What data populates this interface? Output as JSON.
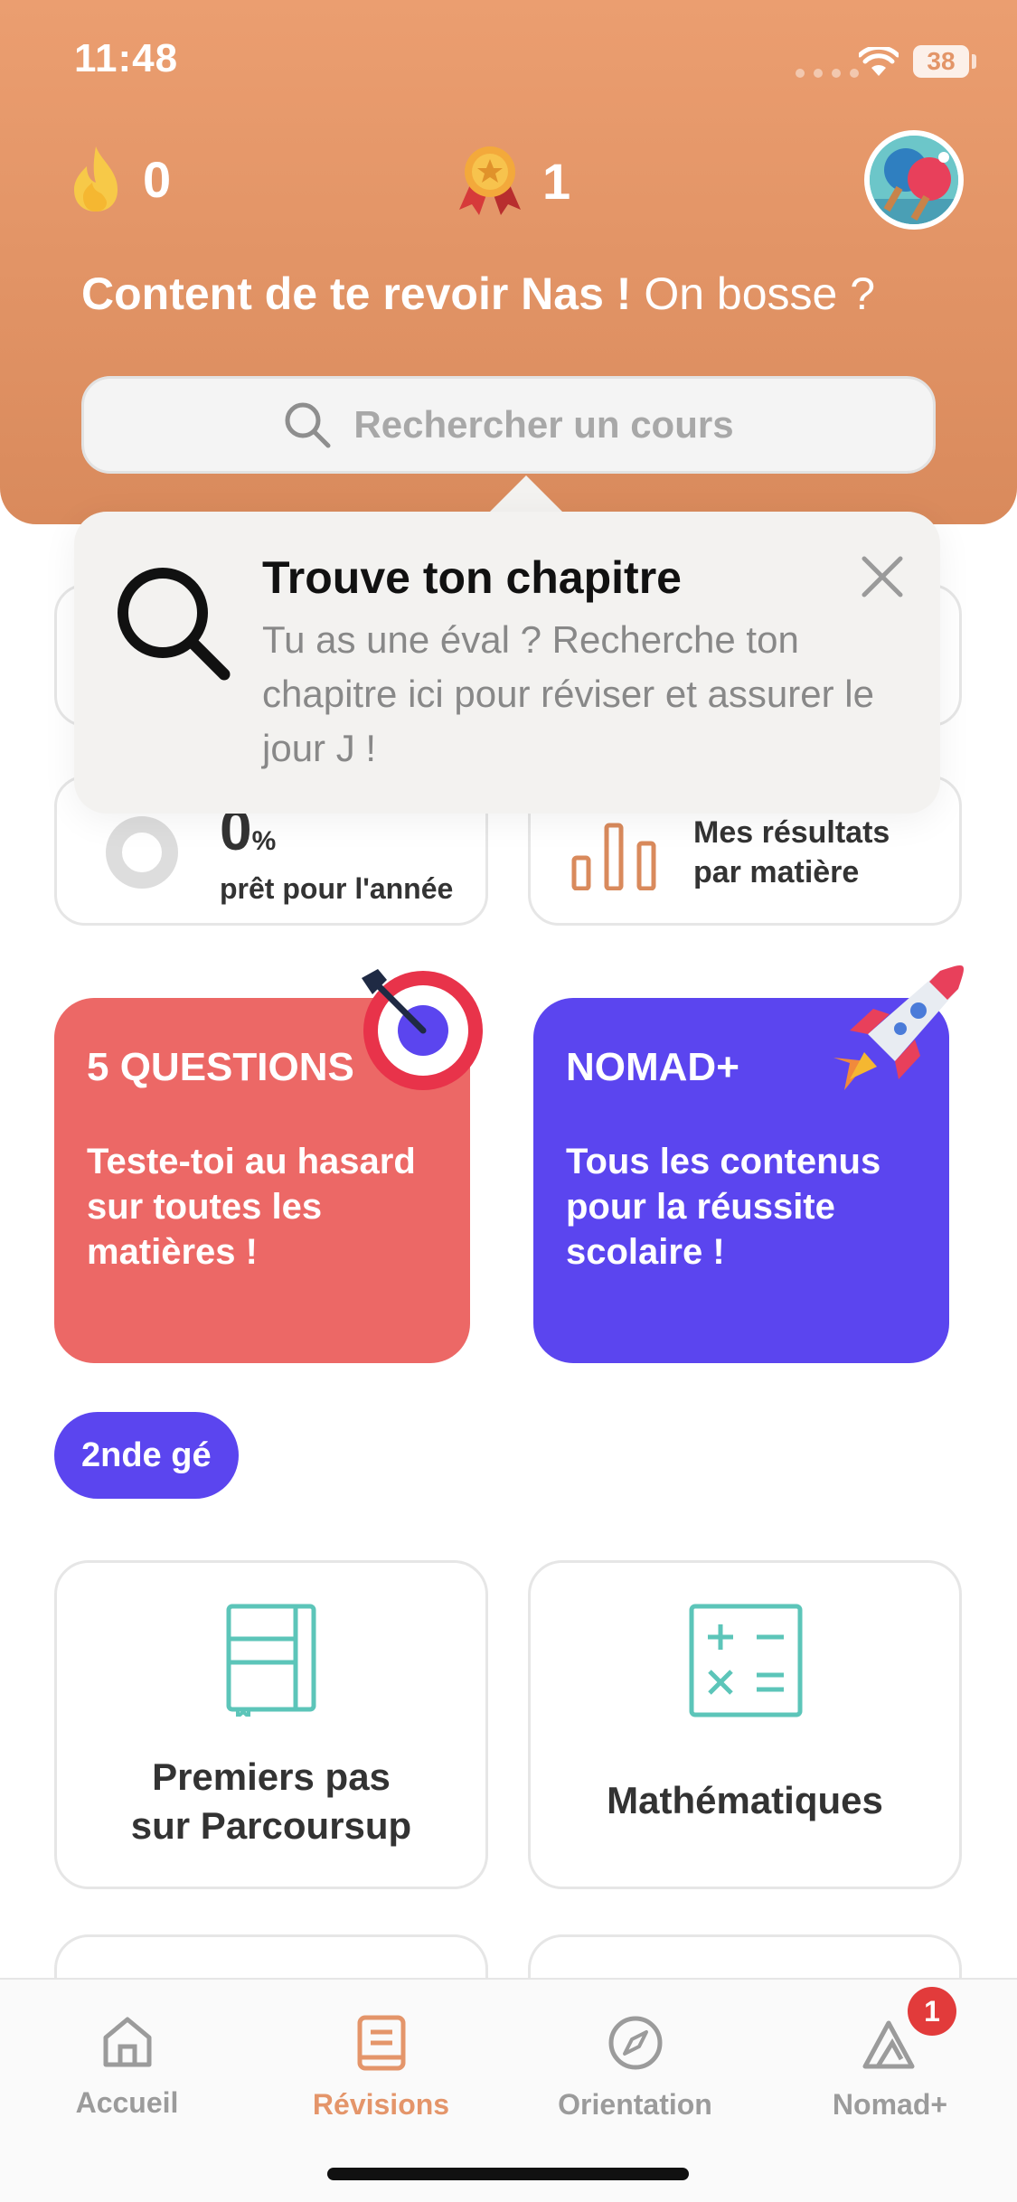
{
  "status_bar": {
    "time": "11:48",
    "battery": "38"
  },
  "header": {
    "streak_count": "0",
    "medal_count": "1",
    "greeting_bold": "Content de te revoir Nas !",
    "greeting_rest": " On bosse ?"
  },
  "search": {
    "placeholder": "Rechercher un cours"
  },
  "tooltip": {
    "title": "Trouve ton chapitre",
    "text": "Tu as une éval ? Recherche ton chapitre ici pour réviser et assurer le jour J !"
  },
  "progress_card": {
    "value": "0",
    "unit": "%",
    "label": "prêt pour l'année"
  },
  "results_card": {
    "label_line1": "Mes résultats",
    "label_line2": "par matière"
  },
  "promo": {
    "questions": {
      "title": "5 QUESTIONS",
      "text": "Teste-toi au hasard sur toutes les matières !"
    },
    "nomad": {
      "title": "NOMAD+",
      "text": "Tous les contenus pour la réussite scolaire !"
    }
  },
  "level_pill": "2nde gé",
  "subjects": [
    {
      "line1": "Premiers pas",
      "line2": "sur Parcoursup"
    },
    {
      "line1": "Mathématiques"
    }
  ],
  "tabs": [
    {
      "label": "Accueil",
      "icon": "home-icon"
    },
    {
      "label": "Révisions",
      "icon": "book-icon"
    },
    {
      "label": "Orientation",
      "icon": "compass-icon"
    },
    {
      "label": "Nomad+",
      "icon": "nomad-icon"
    }
  ],
  "nomad_badge": "1",
  "colors": {
    "header": "#EB9E70",
    "accent_orange": "#E4956A",
    "coral": "#EC6866",
    "purple": "#5B45EF",
    "teal": "#5CC5B9"
  }
}
